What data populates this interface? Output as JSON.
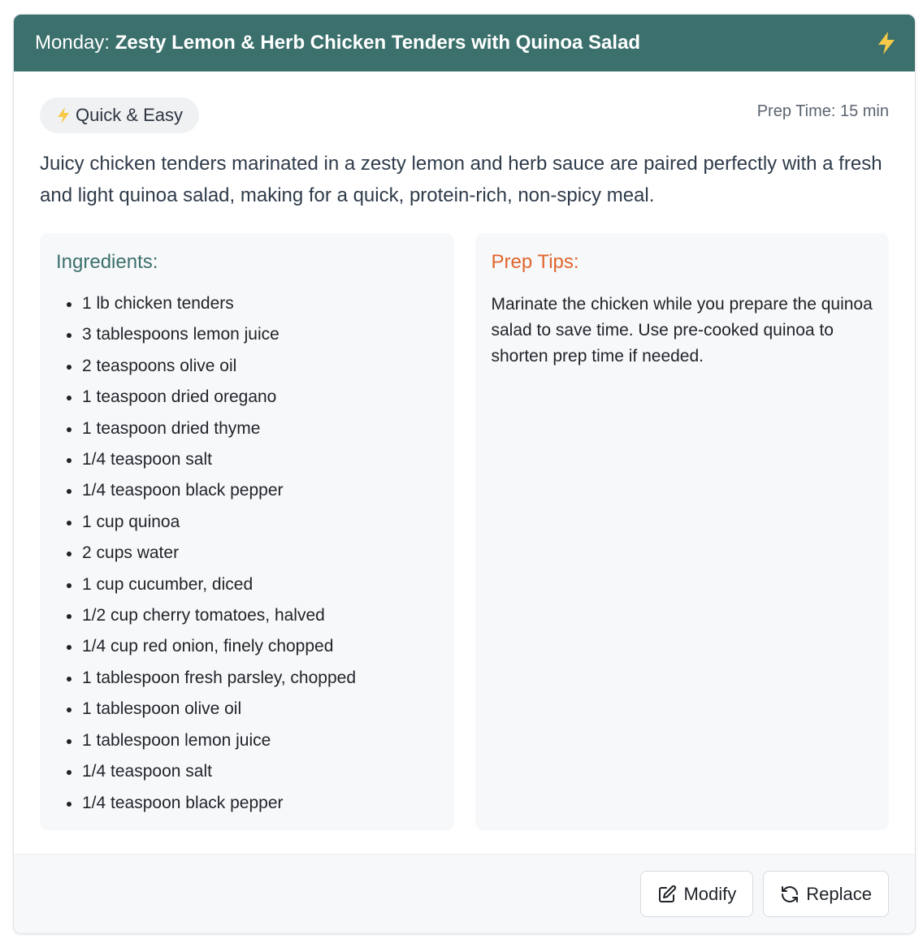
{
  "header": {
    "day_label": "Monday:",
    "meal_title": "Zesty Lemon & Herb Chicken Tenders with Quinoa Salad",
    "icon": "lightning-bolt-icon",
    "accent_color": "#3b706c"
  },
  "meta": {
    "tag_label": "Quick & Easy",
    "tag_icon": "lightning-bolt-icon",
    "prep_time": "Prep Time: 15 min"
  },
  "description": "Juicy chicken tenders marinated in a zesty lemon and herb sauce are paired perfectly with a fresh and light quinoa salad, making for a quick, protein-rich, non-spicy meal.",
  "ingredients": {
    "heading": "Ingredients:",
    "items": [
      "1 lb chicken tenders",
      "3 tablespoons lemon juice",
      "2 teaspoons olive oil",
      "1 teaspoon dried oregano",
      "1 teaspoon dried thyme",
      "1/4 teaspoon salt",
      "1/4 teaspoon black pepper",
      "1 cup quinoa",
      "2 cups water",
      "1 cup cucumber, diced",
      "1/2 cup cherry tomatoes, halved",
      "1/4 cup red onion, finely chopped",
      "1 tablespoon fresh parsley, chopped",
      "1 tablespoon olive oil",
      "1 tablespoon lemon juice",
      "1/4 teaspoon salt",
      "1/4 teaspoon black pepper"
    ]
  },
  "prep_tips": {
    "heading": "Prep Tips:",
    "text": "Marinate the chicken while you prepare the quinoa salad to save time. Use pre-cooked quinoa to shorten prep time if needed.",
    "heading_color": "#e0662e"
  },
  "footer": {
    "modify_label": "Modify",
    "modify_icon": "edit-icon",
    "replace_label": "Replace",
    "replace_icon": "refresh-icon"
  }
}
